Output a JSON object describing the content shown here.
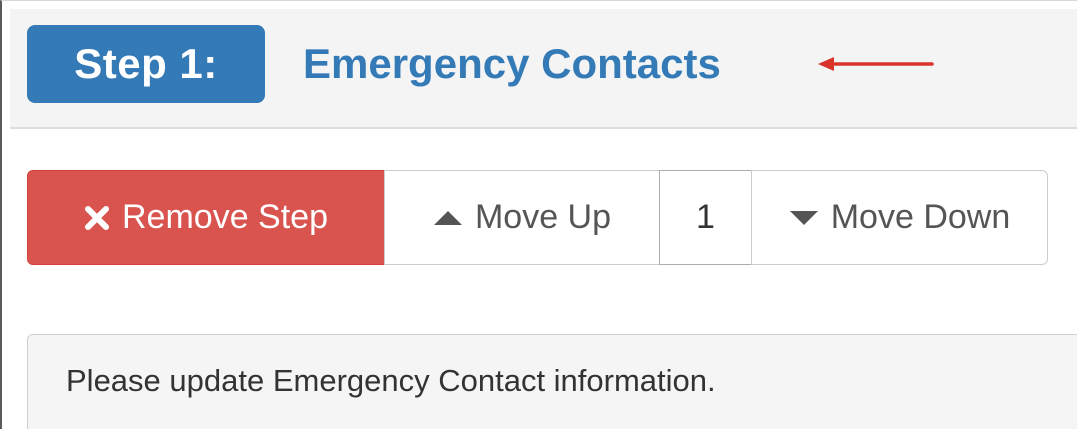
{
  "step": {
    "badge_label": "Step 1:",
    "title": "Emergency Contacts"
  },
  "toolbar": {
    "remove_label": "Remove Step",
    "move_up_label": "Move Up",
    "position_value": "1",
    "move_down_label": "Move Down"
  },
  "icons": {
    "remove": "close-icon",
    "move_up": "caret-up-icon",
    "move_down": "caret-down-icon",
    "annotation": "arrow-left-icon"
  },
  "colors": {
    "primary": "#337ab7",
    "danger": "#d9534f",
    "annotation_arrow": "#d9342b"
  },
  "info": {
    "message": "Please update Emergency Contact information."
  }
}
